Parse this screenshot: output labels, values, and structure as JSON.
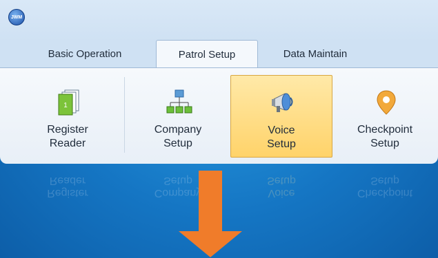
{
  "app": {
    "logo_text": "JWM"
  },
  "tabs": [
    {
      "label": "Basic Operation"
    },
    {
      "label": "Patrol Setup"
    },
    {
      "label": "Data Maintain"
    }
  ],
  "ribbon": {
    "buttons": [
      {
        "label_line1": "Register",
        "label_line2": "Reader",
        "icon": "reader-icon"
      },
      {
        "label_line1": "Company",
        "label_line2": "Setup",
        "icon": "org-chart-icon"
      },
      {
        "label_line1": "Voice",
        "label_line2": "Setup",
        "icon": "megaphone-icon",
        "selected": true
      },
      {
        "label_line1": "Checkpoint",
        "label_line2": "Setup",
        "icon": "location-pin-icon"
      }
    ]
  },
  "colors": {
    "background": "#1576c4",
    "arrow": "#f07c2a",
    "selected_button": "#ffd36a"
  }
}
